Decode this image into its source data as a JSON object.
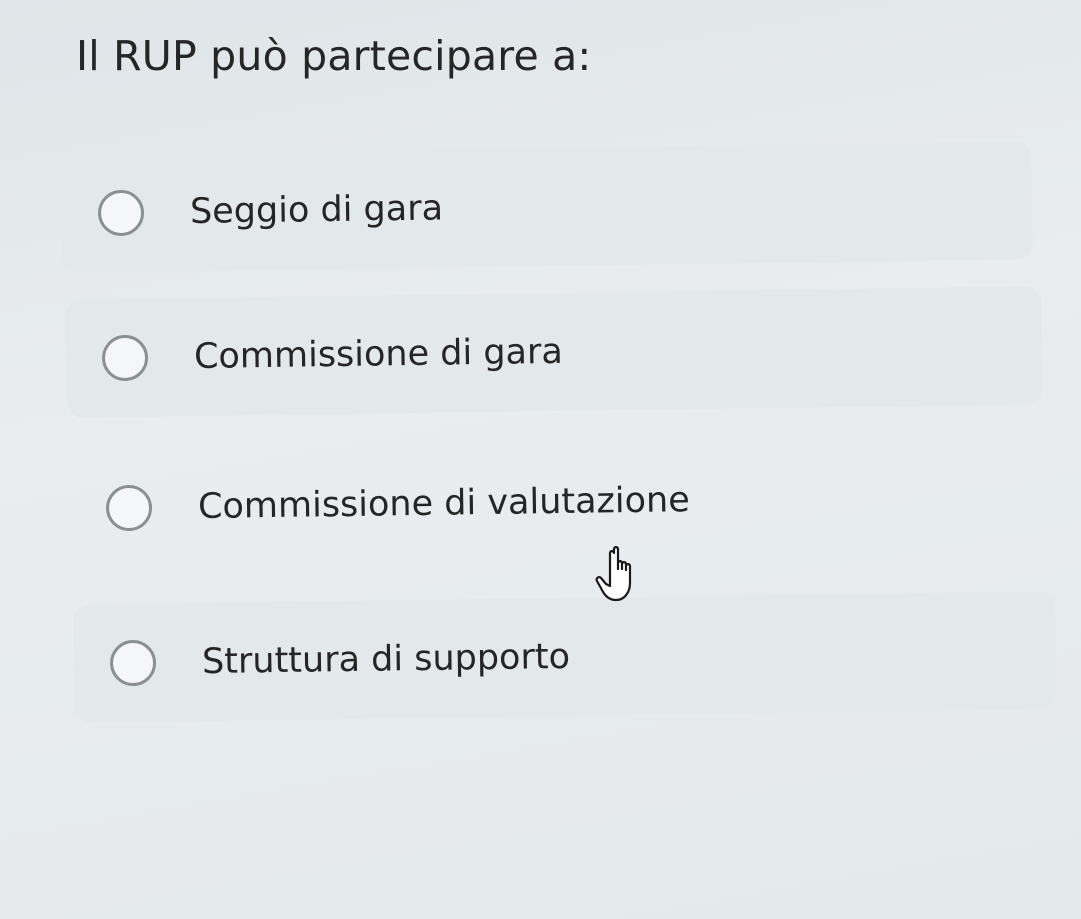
{
  "question": {
    "text": "Il RUP può partecipare a:"
  },
  "options": [
    {
      "label": "Seggio di gara",
      "selected": false
    },
    {
      "label": "Commissione di gara",
      "selected": false
    },
    {
      "label": "Commissione di valutazione",
      "selected": false
    },
    {
      "label": "Struttura di supporto",
      "selected": false
    }
  ],
  "cursor": {
    "icon": "hand-pointer-icon"
  }
}
